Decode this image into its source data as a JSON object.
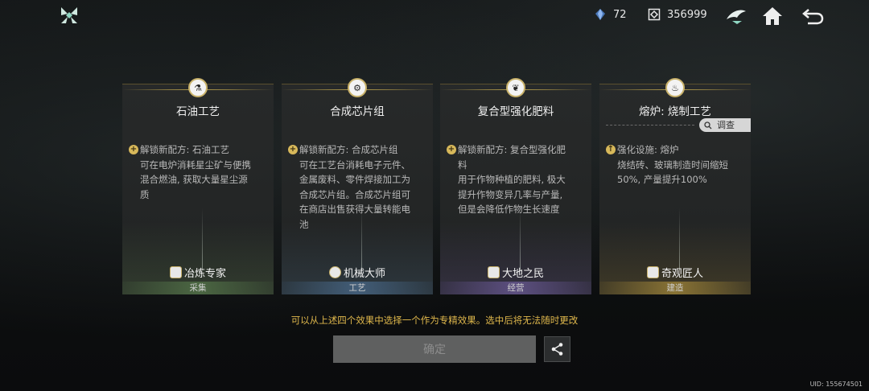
{
  "topbar": {
    "gem_count": "72",
    "coin_count": "356999",
    "icons": [
      "logo-icon",
      "gem-icon",
      "coin-icon",
      "hawk-icon",
      "home-icon",
      "back-icon"
    ]
  },
  "cards": [
    {
      "title": "石油工艺",
      "desc_lines": [
        "解锁新配方: 石油工艺",
        "可在电炉消耗星尘矿与便携",
        "混合燃油, 获取大量星尘源",
        "质"
      ],
      "badge": "冶炼专家",
      "category": "采集"
    },
    {
      "title": "合成芯片组",
      "desc_lines": [
        "解锁新配方: 合成芯片组",
        "可在工艺台消耗电子元件、",
        "金属废料、零件焊接加工为",
        "合成芯片组。合成芯片组可",
        "在商店出售获得大量转能电",
        "池"
      ],
      "badge": "机械大师",
      "category": "工艺"
    },
    {
      "title": "复合型强化肥料",
      "desc_lines": [
        "解锁新配方: 复合型强化肥",
        "料",
        "用于作物种植的肥料, 极大",
        "提升作物变异几率与产量,",
        "但是会降低作物生长速度"
      ],
      "badge": "大地之民",
      "category": "经营"
    },
    {
      "title": "熔炉: 烧制工艺",
      "inspect": "调查",
      "desc_lines": [
        "强化设施: 熔炉",
        "烧结砖、玻璃制造时间缩短",
        "50%, 产量提升100%"
      ],
      "badge": "奇观匠人",
      "category": "建造"
    }
  ],
  "hint": "可以从上述四个效果中选择一个作为专精效果。选中后将无法随时更改",
  "confirm_label": "确定",
  "uid": "UID: 155674501",
  "colors": {
    "accent_gold": "#e0b84c",
    "card_bg": "#2a2c2c",
    "button_disabled": "#5f6060"
  }
}
